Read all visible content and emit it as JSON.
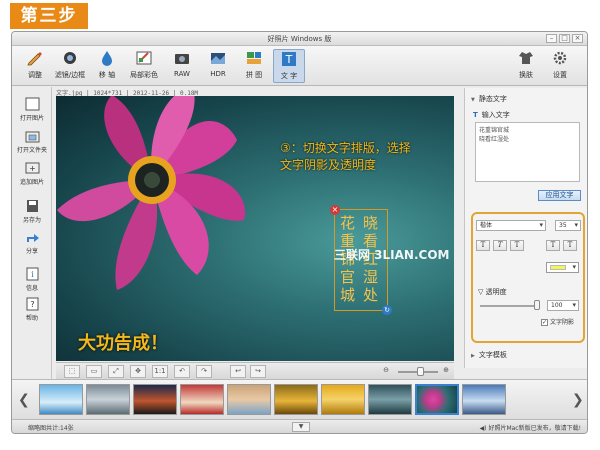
{
  "step_badge": "第三步",
  "window": {
    "title": "好照片 Windows 版"
  },
  "toolbar": {
    "left_tools": [
      {
        "label": "调整",
        "icon": "pencil-icon"
      },
      {
        "label": "滤镜/边框",
        "icon": "filter-icon"
      },
      {
        "label": "移 轴",
        "icon": "tilt-shift-icon"
      },
      {
        "label": "局部彩色",
        "icon": "color-splash-icon"
      },
      {
        "label": "RAW",
        "icon": "raw-camera-icon"
      },
      {
        "label": "HDR",
        "icon": "hdr-icon"
      },
      {
        "label": "拼 图",
        "icon": "collage-icon"
      },
      {
        "label": "文 字",
        "icon": "text-icon"
      }
    ],
    "right_tools": [
      {
        "label": "换肤",
        "icon": "shirt-icon"
      },
      {
        "label": "设置",
        "icon": "gear-icon"
      }
    ]
  },
  "sidebar": {
    "items": [
      {
        "label": "打开图片",
        "icon": "open-image-icon"
      },
      {
        "label": "打开文件夹",
        "icon": "open-folder-icon"
      },
      {
        "label": "追加图片",
        "icon": "add-image-icon"
      },
      {
        "label": "另存为",
        "icon": "save-as-icon"
      },
      {
        "label": "分享",
        "icon": "share-icon"
      },
      {
        "label": "信息",
        "icon": "info-icon"
      },
      {
        "label": "帮助",
        "icon": "help-icon"
      }
    ]
  },
  "file_info": "文字.jpg | 1024*731 | 2012-11-26 | 0.18M",
  "canvas": {
    "annotation_line1": "③：切换文字排版，选择",
    "annotation_line2": "文字阴影及透明度",
    "done_text": "大功告成！",
    "vertical_text_right": "晓看红湿处",
    "vertical_text_left": "花重锦官城",
    "watermark": "三联网 3LIAN.COM"
  },
  "bottom_controls": {
    "one_to_one": "1:1"
  },
  "right_panel": {
    "section_title": "静态文字",
    "input_label": "输入文字",
    "input_value": "花重锦官城\n晓看红湿处",
    "apply_button": "应用文字",
    "font_name": "楷体",
    "font_size": "35",
    "opacity_label": "透明度",
    "opacity_value": "100",
    "opacity_level": 1.0,
    "shadow_label": "文字阴影",
    "shadow_checked": true,
    "template_title": "文字模板",
    "text_color": "#f5f55a"
  },
  "status": {
    "left": "缩略图共计:14张",
    "right": "好照片Mac新版已发布，敬请下载!"
  },
  "colors": {
    "accent_orange": "#e98a16",
    "annotation_gold": "#f2b81a",
    "selection_blue": "#3a7fd0"
  }
}
